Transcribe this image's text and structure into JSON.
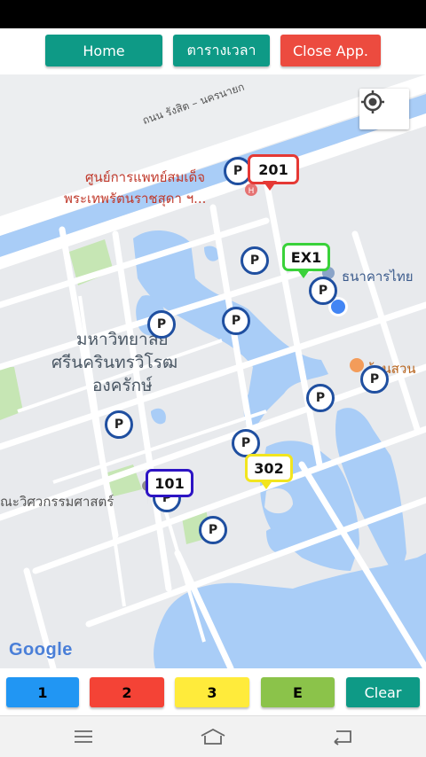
{
  "header": {
    "home_label": "Home",
    "schedule_label": "ตารางเวลา",
    "close_label": "Close App.",
    "colors": {
      "teal": "#0e9a86",
      "red": "#ec4b3f"
    }
  },
  "map": {
    "road_label": "ถนน รังสิต – นครนายก",
    "hospital_name_line1": "ศูนย์การแพทย์สมเด็จ",
    "hospital_name_line2": "พระเทพรัตนราชสุดา ฯ...",
    "bank_label": "ธนาคารไทย",
    "restaurant_label": "ร้านสวน",
    "university_line1": "มหาวิทยาลัย",
    "university_line2": "ศรีนครินทรวิโรฒ",
    "university_line3": "องครักษ์",
    "faculty_label": "ณะวิศวกรรมศาสตร์",
    "google_text": "Google",
    "parking_marker_text": "P",
    "route_markers": [
      {
        "label": "201",
        "color": "#e53935"
      },
      {
        "label": "EX1",
        "color": "#3ad23a"
      },
      {
        "label": "302",
        "color": "#f2e51f"
      },
      {
        "label": "101",
        "color": "#2d14c4"
      }
    ]
  },
  "bottom_buttons": [
    {
      "label": "1",
      "color": "#2196f3"
    },
    {
      "label": "2",
      "color": "#f44336"
    },
    {
      "label": "3",
      "color": "#ffeb3b"
    },
    {
      "label": "E",
      "color": "#8bc34a"
    },
    {
      "label": "Clear",
      "color": "#0e9a86"
    }
  ]
}
